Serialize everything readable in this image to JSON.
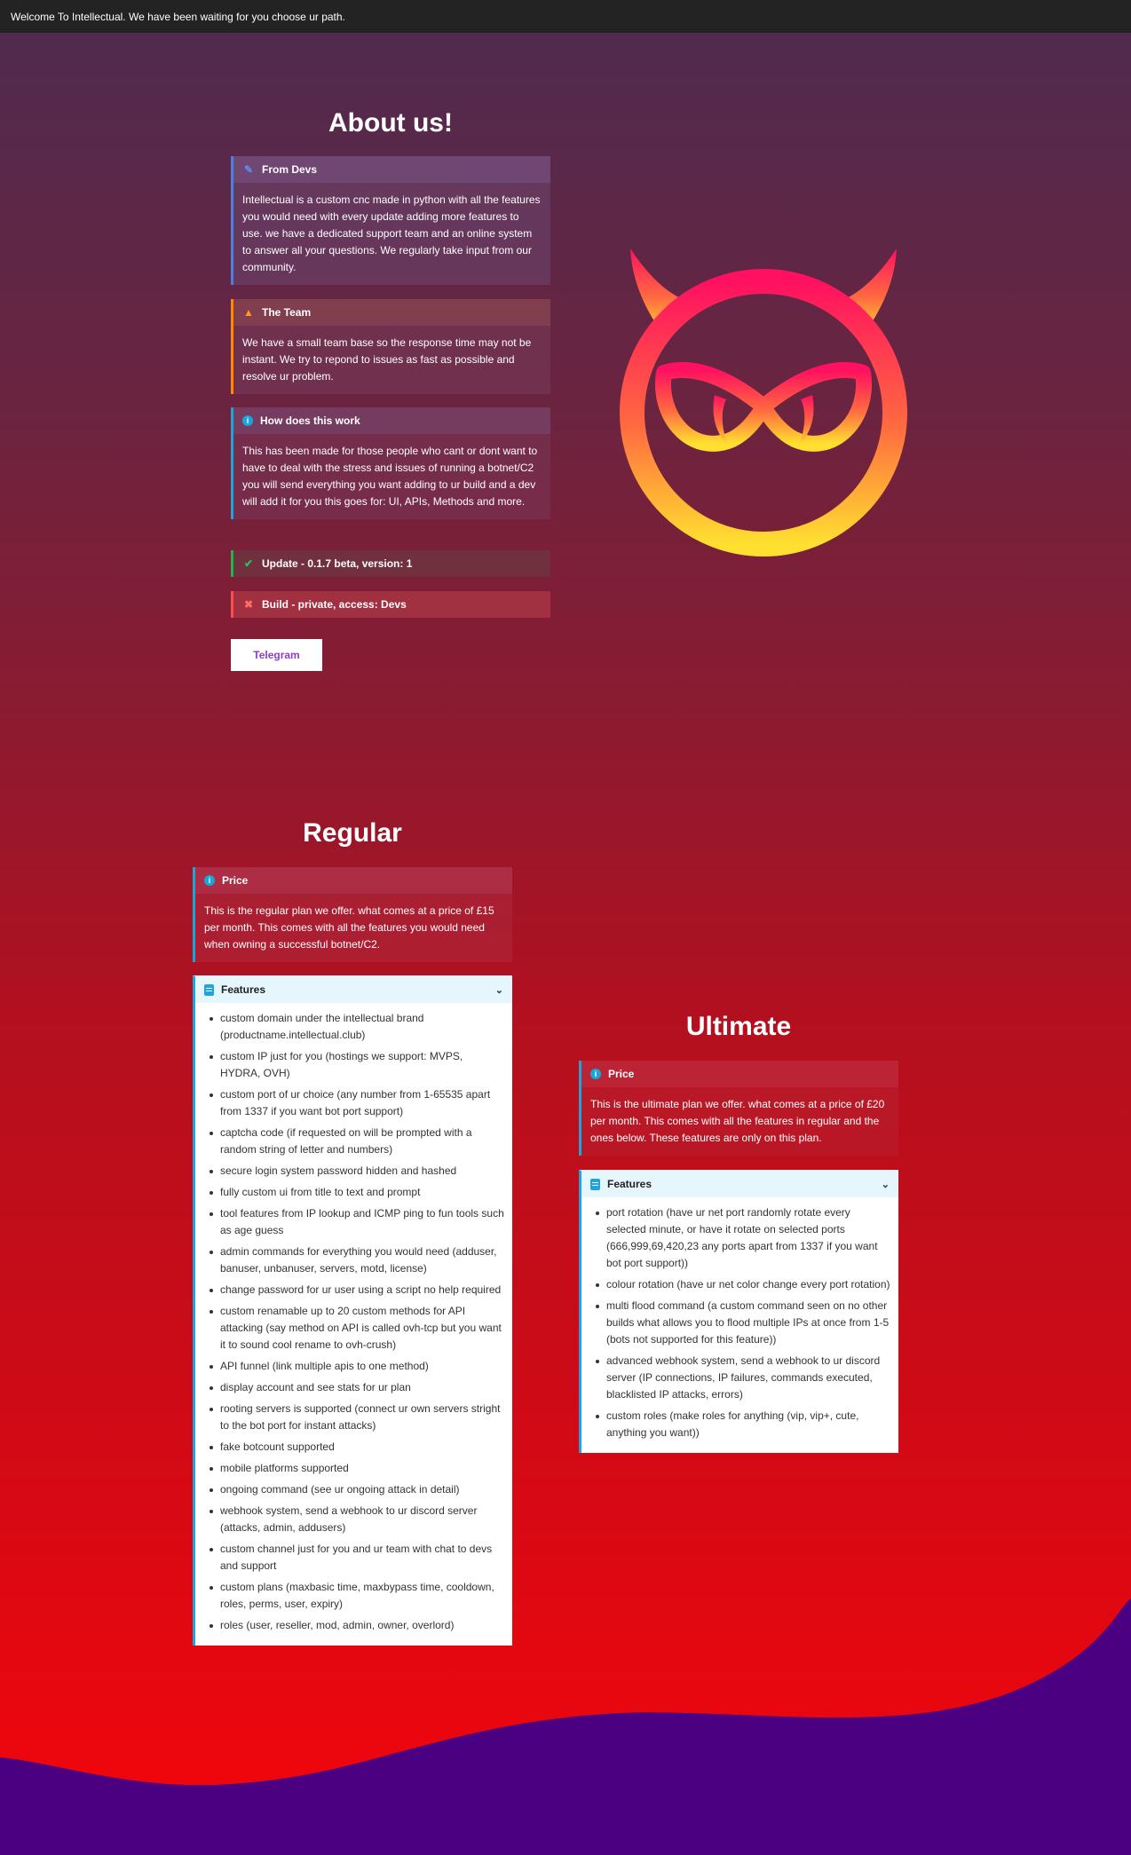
{
  "topbar": {
    "text": "Welcome To Intellectual. We have been waiting for you choose ur path."
  },
  "about": {
    "title": "About us!",
    "from_devs": {
      "title": "From Devs",
      "body": "Intellectual is a custom cnc made in python with all the features you would need with every update adding more features to use. we have a dedicated support team and an online system to answer all your questions. We regularly take input from our community."
    },
    "team": {
      "title": "The Team",
      "body": "We have a small team base so the response time may not be instant. We try to repond to issues as fast as possible and resolve ur problem."
    },
    "how": {
      "title": "How does this work",
      "body": "This has been made for those people who cant or dont want to have to deal with the stress and issues of running a botnet/C2 you will send everything you want adding to ur build and a dev will add it for you this goes for: UI, APIs, Methods and more."
    },
    "update": {
      "title": "Update - 0.1.7 beta, version: 1"
    },
    "build": {
      "title": "Build - private, access: Devs"
    },
    "telegram_button": "Telegram"
  },
  "regular": {
    "title": "Regular",
    "price_title": "Price",
    "price_body": "This is the regular plan we offer. what comes at a price of £15 per month. This comes with all the features you would need when owning a successful botnet/C2.",
    "features_title": "Features",
    "features": [
      "custom domain under the intellectual brand (productname.intellectual.club)",
      "custom IP just for you (hostings we support: MVPS, HYDRA, OVH)",
      "custom port of ur choice (any number from 1-65535 apart from 1337 if you want bot port support)",
      "captcha code (if requested on will be prompted with a random string of letter and numbers)",
      "secure login system password hidden and hashed",
      "fully custom ui from title to text and prompt",
      "tool features from IP lookup and ICMP ping to fun tools such as age guess",
      "admin commands for everything you would need (adduser, banuser, unbanuser, servers, motd, license)",
      "change password for ur user using a script no help required",
      "custom renamable up to 20 custom methods for API attacking (say method on API is called ovh-tcp but you want it to sound cool rename to ovh-crush)",
      "API funnel (link multiple apis to one method)",
      "display account and see stats for ur plan",
      "rooting servers is supported (connect ur own servers stright to the bot port for instant attacks)",
      "fake botcount supported",
      "mobile platforms supported",
      "ongoing command (see ur ongoing attack in detail)",
      "webhook system, send a webhook to ur discord server (attacks, admin, addusers)",
      "custom channel just for you and ur team with chat to devs and support",
      "custom plans (maxbasic time, maxbypass time, cooldown, roles, perms, user, expiry)",
      "roles (user, reseller, mod, admin, owner, overlord)"
    ]
  },
  "ultimate": {
    "title": "Ultimate",
    "price_title": "Price",
    "price_body": "This is the ultimate plan we offer. what comes at a price of £20 per month. This comes with all the features in regular and the ones below. These features are only on this plan.",
    "features_title": "Features",
    "features": [
      "port rotation (have ur net port randomly rotate every selected minute, or have it rotate on selected ports (666,999,69,420,23 any ports apart from 1337 if you want bot port support))",
      "colour rotation (have ur net color change every port rotation)",
      "multi flood command (a custom command seen on no other builds what allows you to flood multiple IPs at once from 1-5 (bots not supported for this feature))",
      "advanced webhook system, send a webhook to ur discord server (IP connections, IP failures, commands executed, blacklisted IP attacks, errors)",
      "custom roles (make roles for anything (vip, vip+, cute, anything you want))"
    ]
  },
  "icons": {
    "from_devs": "pencil-icon",
    "team": "warning-icon",
    "how": "info-icon",
    "update": "check-icon",
    "build": "cross-icon",
    "features": "note-icon",
    "logo": "devil-owl-logo"
  },
  "colors": {
    "blue_accent": "#4a80e0",
    "orange_accent": "#ff8a00",
    "cyan_accent": "#1aa6d8",
    "green_accent": "#1fb450",
    "red_accent": "#ff4d4d",
    "purple_wave": "#4b0082",
    "button_text": "#8e3ec9"
  }
}
